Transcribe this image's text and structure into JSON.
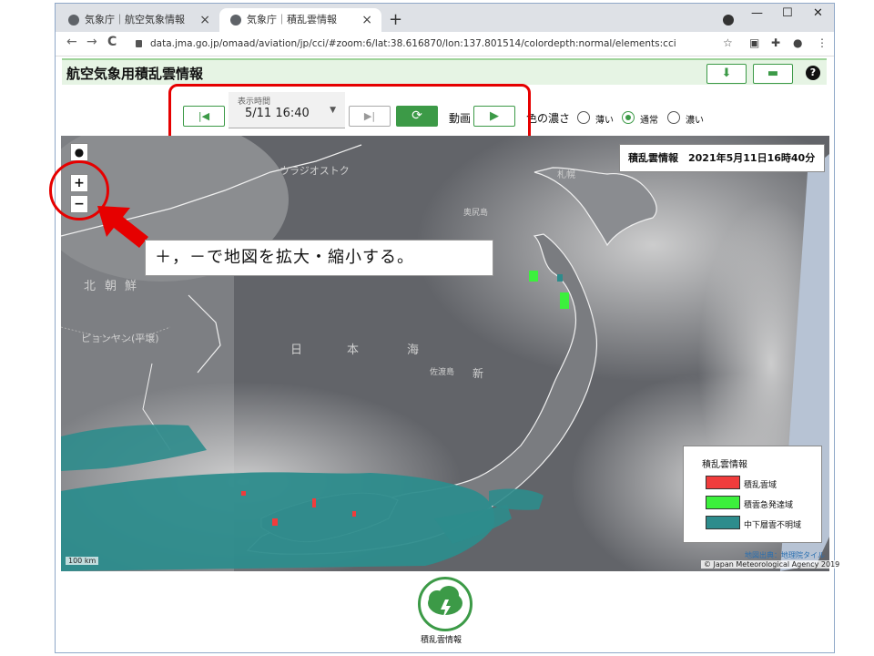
{
  "browser": {
    "tabs": [
      {
        "title": "気象庁｜航空気象情報"
      },
      {
        "title": "気象庁｜積乱雲情報"
      }
    ],
    "new_tab": "+",
    "controls": {
      "minimize": "—",
      "maximize": "☐",
      "close": "✕"
    },
    "nav": {
      "back": "←",
      "forward": "→",
      "reload": "C"
    },
    "url": "data.jma.go.jp/omaad/aviation/jp/cci/#zoom:6/lat:38.616870/lon:137.801514/colordepth:normal/elements:cci",
    "toolbar_icons": [
      "star-icon",
      "pdf-icon",
      "puzzle-icon",
      "profile-icon",
      "more-icon"
    ]
  },
  "page": {
    "title": "航空気象用積乱雲情報",
    "help": "?"
  },
  "toolbar": {
    "time_label": "表示時間",
    "time_value": "5/11 16:40",
    "anim_label": "動画",
    "density_label": "色の濃さ",
    "density_options": [
      {
        "label": "薄い",
        "checked": false
      },
      {
        "label": "通常",
        "checked": true
      },
      {
        "label": "濃い",
        "checked": false
      }
    ]
  },
  "map": {
    "zoom_in": "+",
    "zoom_out": "−",
    "timestamp": "積乱雲情報　2021年5月11日16時40分",
    "labels": [
      "ウラジオストク",
      "北",
      "朝",
      "鮮",
      "ピョンヤン(平壌)",
      "日",
      "本",
      "海",
      "佐渡島",
      "新",
      "札幌",
      "奥尻島"
    ],
    "legend": {
      "title": "積乱雲情報",
      "items": [
        {
          "label": "積乱雲域",
          "color": "#f03c3c"
        },
        {
          "label": "積雲急発達域",
          "color": "#3cf03c"
        },
        {
          "label": "中下層雲不明域",
          "color": "#2d8c8c"
        }
      ]
    },
    "scale": "100 km",
    "attribution": "地図出典：地理院タイル",
    "copyright": "© Japan Meteorological Agency 2019"
  },
  "annotation": {
    "callout": "＋，－で地図を拡大・縮小する。"
  },
  "footer": {
    "label": "積乱雲情報"
  }
}
